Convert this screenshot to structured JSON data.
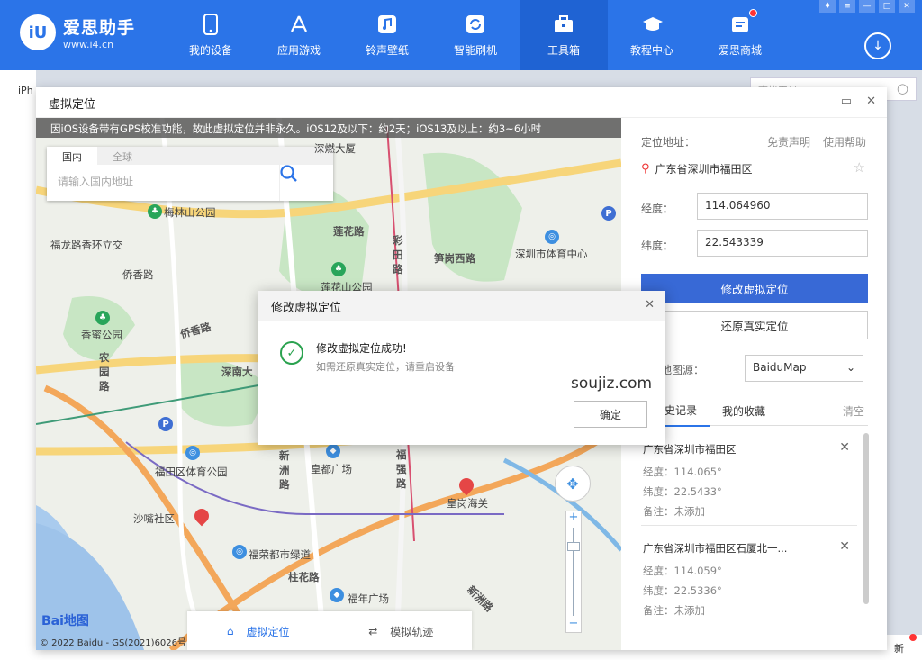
{
  "app": {
    "logo_name": "爱思助手",
    "logo_url": "www.i4.cn",
    "logo_badge": "iU"
  },
  "nav": [
    {
      "label": "我的设备",
      "icon": "phone-icon"
    },
    {
      "label": "应用游戏",
      "icon": "app-store-icon"
    },
    {
      "label": "铃声壁纸",
      "icon": "music-icon"
    },
    {
      "label": "智能刷机",
      "icon": "refresh-icon"
    },
    {
      "label": "工具箱",
      "icon": "toolbox-icon",
      "active": true
    },
    {
      "label": "教程中心",
      "icon": "graduation-cap-icon"
    },
    {
      "label": "爱思商城",
      "icon": "shop-icon"
    }
  ],
  "background": {
    "left_label": "iPh",
    "search_placeholder": "查找工具",
    "corner_text": "新"
  },
  "dialog": {
    "title": "虚拟定位"
  },
  "map": {
    "notice": "因iOS设备带有GPS校准功能，故此虚拟定位并非永久。iOS12及以下：约2天；iOS13及以上：约3~6小时",
    "tab_domestic": "国内",
    "tab_global": "全球",
    "search_placeholder": "请输入国内地址",
    "logo_text": "Bai",
    "logo_text2": "地图",
    "copyright": "© 2022 Baidu - GS(2021)6026号",
    "labels": [
      "深燃大厦",
      "梅林山公园",
      "福龙路香环立交",
      "侨香路",
      "莲花路",
      "彩田路",
      "笋岗西路",
      "深圳市体育中心",
      "香蜜公园",
      "莲花山公园",
      "农园路",
      "侨香路",
      "深南大",
      "福田区体育公园",
      "新洲路",
      "皇都广场",
      "福强路",
      "皇岗海关",
      "沙嘴社区",
      "福荣都市绿道",
      "柱花路",
      "福年广场",
      "新洲路"
    ]
  },
  "bottom_tabs": {
    "virtual": "虚拟定位",
    "track": "模拟轨迹"
  },
  "panel": {
    "location_label": "定位地址：",
    "disclaimer": "免责声明",
    "help": "使用帮助",
    "address": "广东省深圳市福田区",
    "lng_label": "经度：",
    "lng_value": "114.064960",
    "lat_label": "纬度：",
    "lat_value": "22.543339",
    "modify_btn": "修改虚拟定位",
    "restore_btn": "还原真实定位",
    "source_label": "地图源：",
    "source_value": "BaiduMap",
    "tab_history": "历史记录",
    "tab_fav": "我的收藏",
    "clear": "清空"
  },
  "history": [
    {
      "title": "广东省深圳市福田区",
      "lng": "经度：114.065°",
      "lat": "纬度：22.5433°",
      "note": "备注：未添加"
    },
    {
      "title": "广东省深圳市福田区石厦北一...",
      "lng": "经度：114.059°",
      "lat": "纬度：22.5336°",
      "note": "备注：未添加"
    }
  ],
  "modal": {
    "title": "修改虚拟定位",
    "message": "修改虚拟定位成功!",
    "sub": "如需还原真实定位，请重启设备",
    "ok": "确定"
  },
  "watermark": "soujiz.com"
}
